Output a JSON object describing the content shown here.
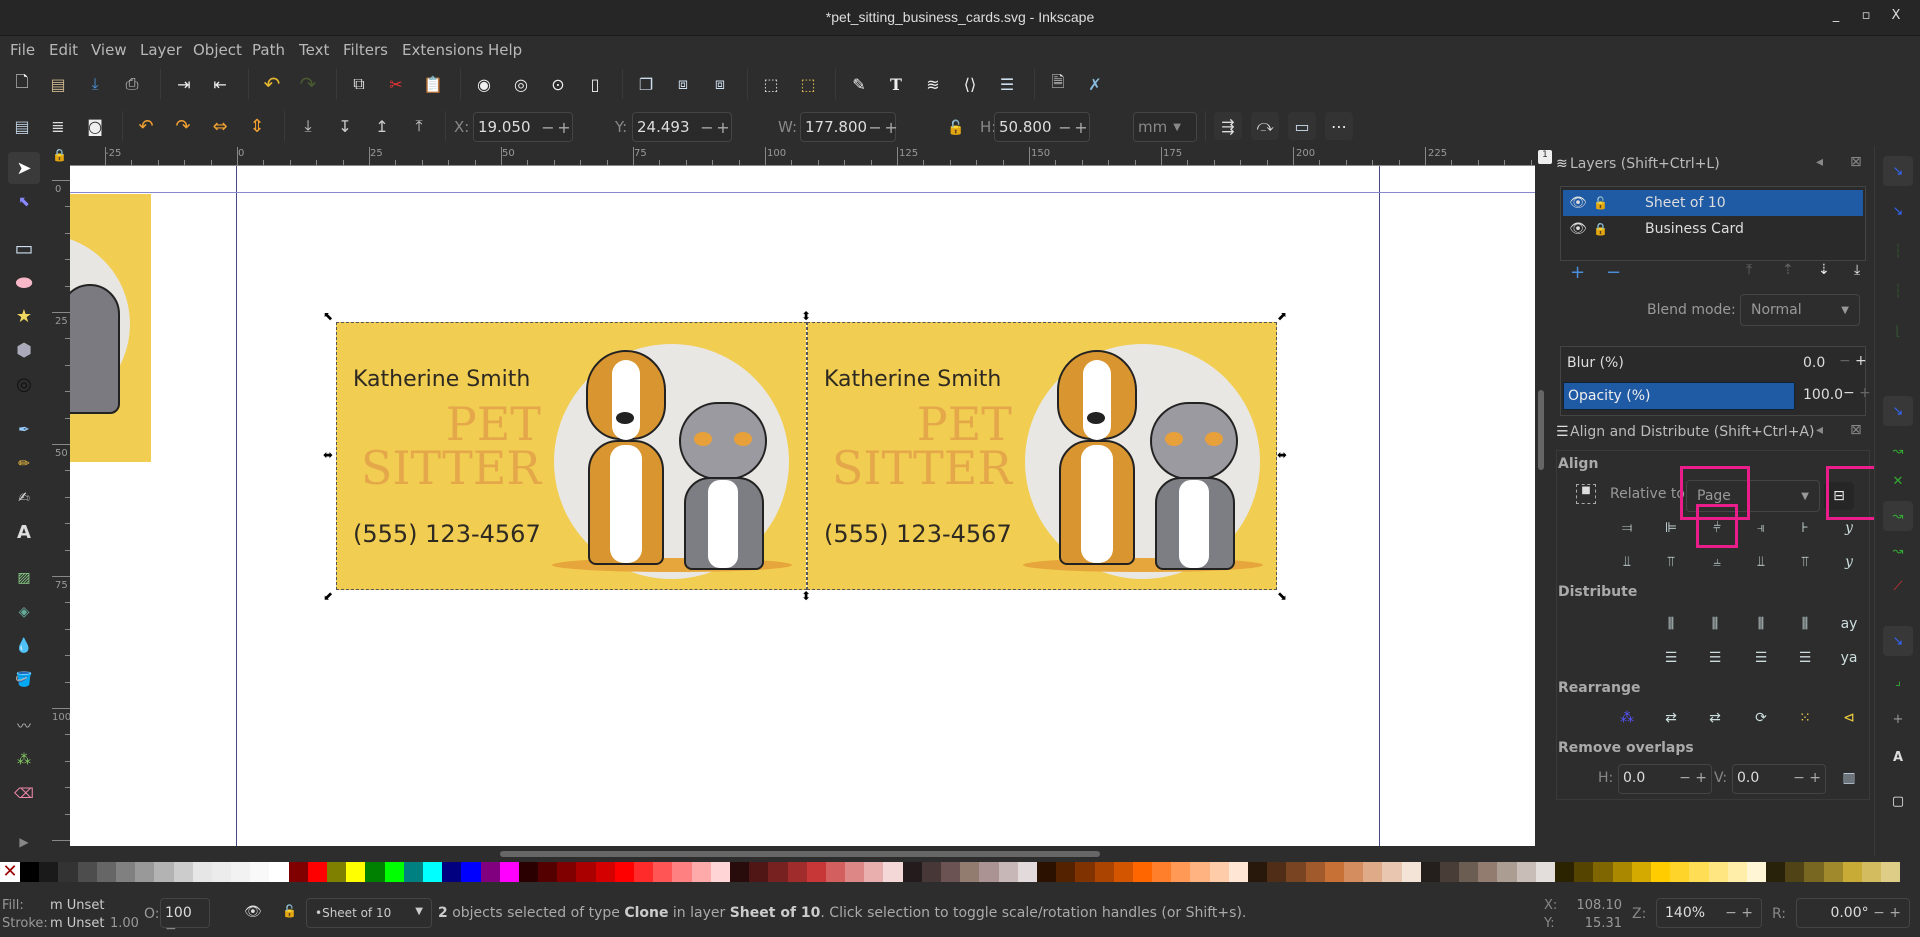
{
  "window": {
    "title": "*pet_sitting_business_cards.svg - Inkscape",
    "controls": [
      "_",
      "▫",
      "X"
    ]
  },
  "menu": [
    "File",
    "Edit",
    "View",
    "Layer",
    "Object",
    "Path",
    "Text",
    "Filters",
    "Extensions",
    "Help"
  ],
  "command_bar_icons": [
    "new-document",
    "open",
    "save",
    "print",
    "import",
    "export",
    "undo",
    "redo",
    "copy",
    "cut",
    "paste",
    "zoom-selection",
    "zoom-drawing",
    "zoom-page",
    "zoom-page-width",
    "duplicate",
    "clone",
    "unlink-clone",
    "group",
    "ungroup",
    "fill-stroke",
    "text-font",
    "layers",
    "xml-editor",
    "align-distribute",
    "document-properties",
    "preferences"
  ],
  "controls": {
    "x_label": "X:",
    "x": "19.050",
    "y_label": "Y:",
    "y": "24.493",
    "w_label": "W:",
    "w": "177.800",
    "h_label": "H:",
    "h": "50.800",
    "unit": "mm"
  },
  "ruler_top": [
    "-25",
    "0",
    "25",
    "50",
    "75",
    "100",
    "125",
    "150",
    "175",
    "200",
    "225"
  ],
  "ruler_left": [
    "0",
    "25",
    "50",
    "75",
    "100"
  ],
  "page_badge": "1",
  "cards": [
    {
      "name": "Katherine Smith",
      "title_line1": "PET",
      "title_line2": "SITTER",
      "phone": "(555) 123-4567"
    },
    {
      "name": "Katherine Smith",
      "title_line1": "PET",
      "title_line2": "SITTER",
      "phone": "(555) 123-4567"
    }
  ],
  "layers_panel": {
    "title": "Layers (Shift+Ctrl+L)",
    "layers": [
      {
        "name": "Sheet of 10",
        "visible": true,
        "locked": false,
        "selected": true
      },
      {
        "name": "Business Card",
        "visible": true,
        "locked": true,
        "selected": false
      }
    ],
    "blend_label": "Blend mode:",
    "blend_value": "Normal",
    "blur_label": "Blur (%)",
    "blur_value": "0.0",
    "opacity_label": "Opacity (%)",
    "opacity_value": "100.0"
  },
  "align_panel": {
    "title": "Align and Distribute (Shift+Ctrl+A)",
    "align_label": "Align",
    "relative_label": "Relative to",
    "relative_value": "Page",
    "distribute_label": "Distribute",
    "rearrange_label": "Rearrange",
    "remove_overlaps_label": "Remove overlaps",
    "h_label": "H:",
    "h_value": "0.0",
    "v_label": "V:",
    "v_value": "0.0",
    "highlight_color": "#e91e8a"
  },
  "status": {
    "fill_label": "Fill:",
    "fill_value": "Unset",
    "stroke_label": "Stroke:",
    "stroke_value": "Unset",
    "stroke_width": "1.00",
    "opacity_label": "O:",
    "opacity_value": "100",
    "layer_value": "•Sheet of 10",
    "message_count": "2",
    "message_part1": " objects selected of type ",
    "message_type": "Clone",
    "message_part2": " in layer ",
    "message_layer": "Sheet of 10",
    "message_part3": ". Click selection to toggle scale/rotation handles (or Shift+s).",
    "cursor_x_label": "X:",
    "cursor_x": "108.10",
    "cursor_y_label": "Y:",
    "cursor_y": "15.31",
    "zoom_label": "Z:",
    "zoom": "140%",
    "rotate_label": "R:",
    "rotate": "0.00°"
  },
  "palette": [
    "#000000",
    "#1a1a1a",
    "#333333",
    "#4d4d4d",
    "#666666",
    "#808080",
    "#999999",
    "#b3b3b3",
    "#cccccc",
    "#e6e6e6",
    "#ececec",
    "#f2f2f2",
    "#f9f9f9",
    "#ffffff",
    "#800000",
    "#ff0000",
    "#808000",
    "#ffff00",
    "#008000",
    "#00ff00",
    "#008080",
    "#00ffff",
    "#000080",
    "#0000ff",
    "#800080",
    "#ff00ff",
    "#2b0000",
    "#550000",
    "#800000",
    "#aa0000",
    "#d40000",
    "#ff0000",
    "#ff2a2a",
    "#ff5555",
    "#ff8080",
    "#ffaaaa",
    "#ffd5d5",
    "#280b0b",
    "#501616",
    "#782121",
    "#a02c2c",
    "#c83737",
    "#d35f5f",
    "#de8787",
    "#e9afaf",
    "#f4d7d7",
    "#241c1c",
    "#483737",
    "#6c5353",
    "#917c6f",
    "#ac9393",
    "#c8b7b7",
    "#e3dbdb",
    "#2b1100",
    "#552200",
    "#803300",
    "#aa4400",
    "#d45500",
    "#ff6600",
    "#ff7f2a",
    "#ff9955",
    "#ffb380",
    "#ffccaa",
    "#ffe6d5",
    "#28170b",
    "#502d16",
    "#784421",
    "#a05a2c",
    "#c87137",
    "#d38d5f",
    "#deaa87",
    "#e9c6af",
    "#f4e3d7",
    "#241f1c",
    "#483e37",
    "#6c5d53",
    "#917c6f",
    "#ac9d93",
    "#c8beb7",
    "#e3dedb",
    "#2b2200",
    "#554400",
    "#806600",
    "#aa8800",
    "#d4aa00",
    "#ffcc00",
    "#ffd42a",
    "#ffdd55",
    "#ffe680",
    "#ffeeaa",
    "#fff6d5",
    "#28220b",
    "#504416",
    "#786721",
    "#a0892c",
    "#c8ab37",
    "#d3bc5f",
    "#decd87"
  ]
}
